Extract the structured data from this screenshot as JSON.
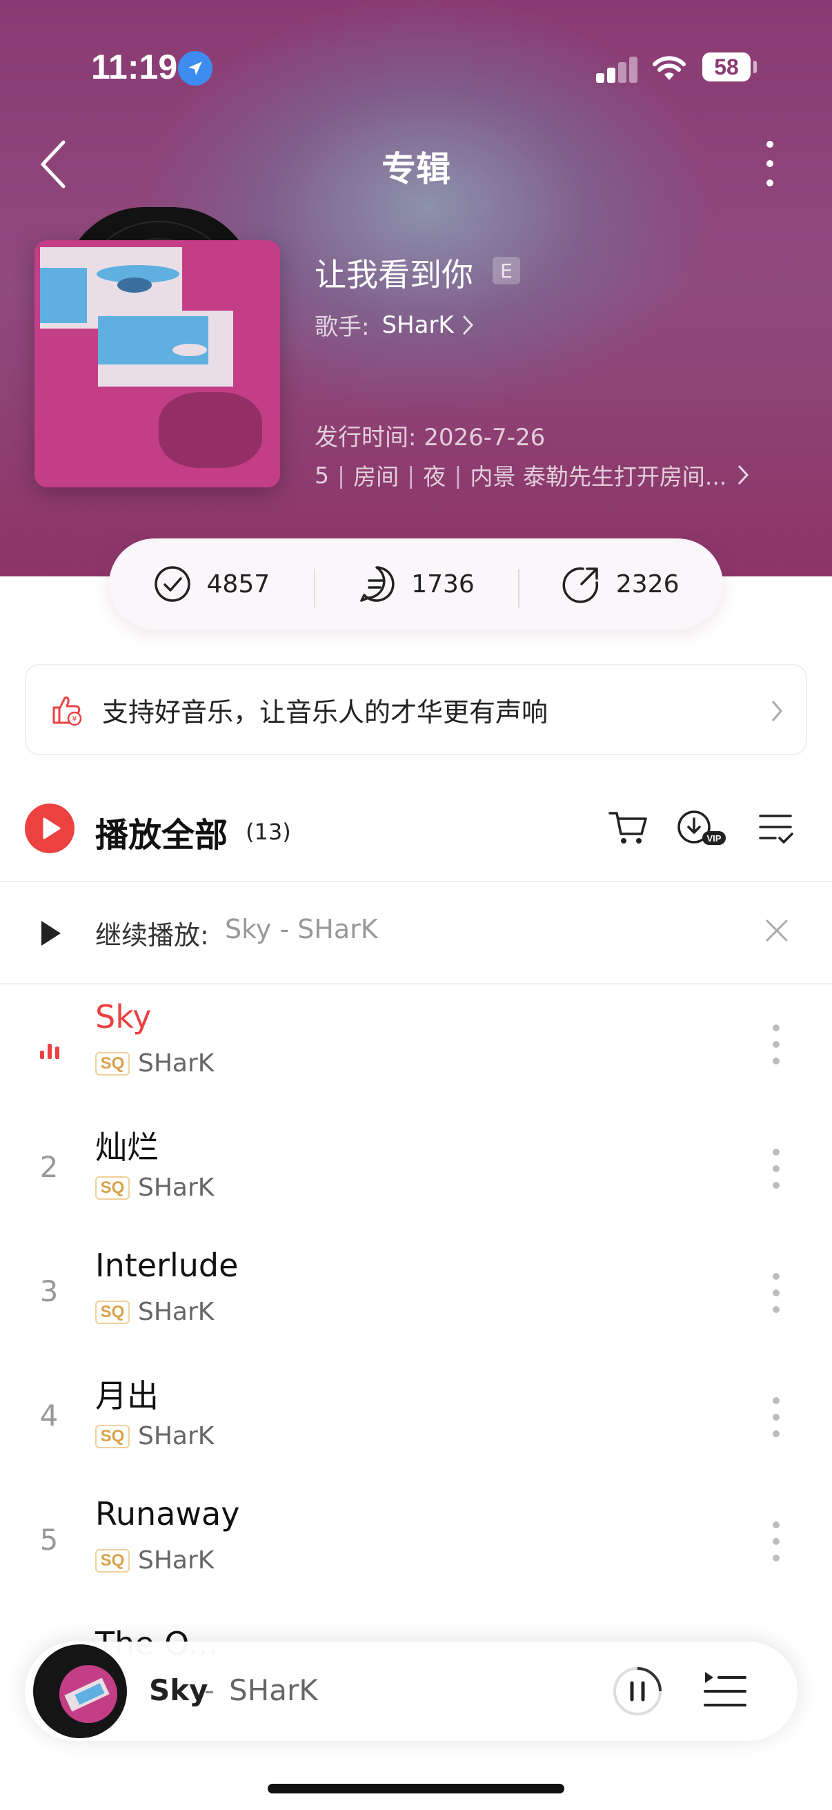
{
  "status_bar": {
    "time": "11:19",
    "battery": "58"
  },
  "nav": {
    "title": "专辑"
  },
  "album": {
    "title": "让我看到你",
    "explicit_badge": "E",
    "artist_label": "歌手:",
    "artist": "SHarK",
    "release": "发行时间: 2026-7-26",
    "tags": [
      "5",
      "房间",
      "夜",
      "内景 泰勒先生打开房间..."
    ]
  },
  "stats": {
    "collect": "4857",
    "comments": "1736",
    "shares": "2326"
  },
  "support_banner": {
    "text": "支持好音乐，让音乐人的才华更有声响"
  },
  "play_all": {
    "label": "播放全部",
    "count": "(13)"
  },
  "continue": {
    "label": "继续播放:",
    "song": "Sky - SHarK"
  },
  "songs": [
    {
      "index": "",
      "title": "Sky",
      "quality": "SQ",
      "artist": "SHarK",
      "playing": true
    },
    {
      "index": "2",
      "title": "灿烂",
      "quality": "SQ",
      "artist": "SHarK"
    },
    {
      "index": "3",
      "title": "Interlude",
      "quality": "SQ",
      "artist": "SHarK"
    },
    {
      "index": "4",
      "title": "月出",
      "quality": "SQ",
      "artist": "SHarK"
    },
    {
      "index": "5",
      "title": "Runaway",
      "quality": "SQ",
      "artist": "SHarK"
    }
  ],
  "partial_song": {
    "title": "The O..."
  },
  "mini_player": {
    "title": "Sky",
    "separator": "-",
    "artist": "SHarK"
  },
  "colors": {
    "accent": "#ec4141",
    "hero": "#8a3a72",
    "sq_gold": "#d9a14a"
  }
}
